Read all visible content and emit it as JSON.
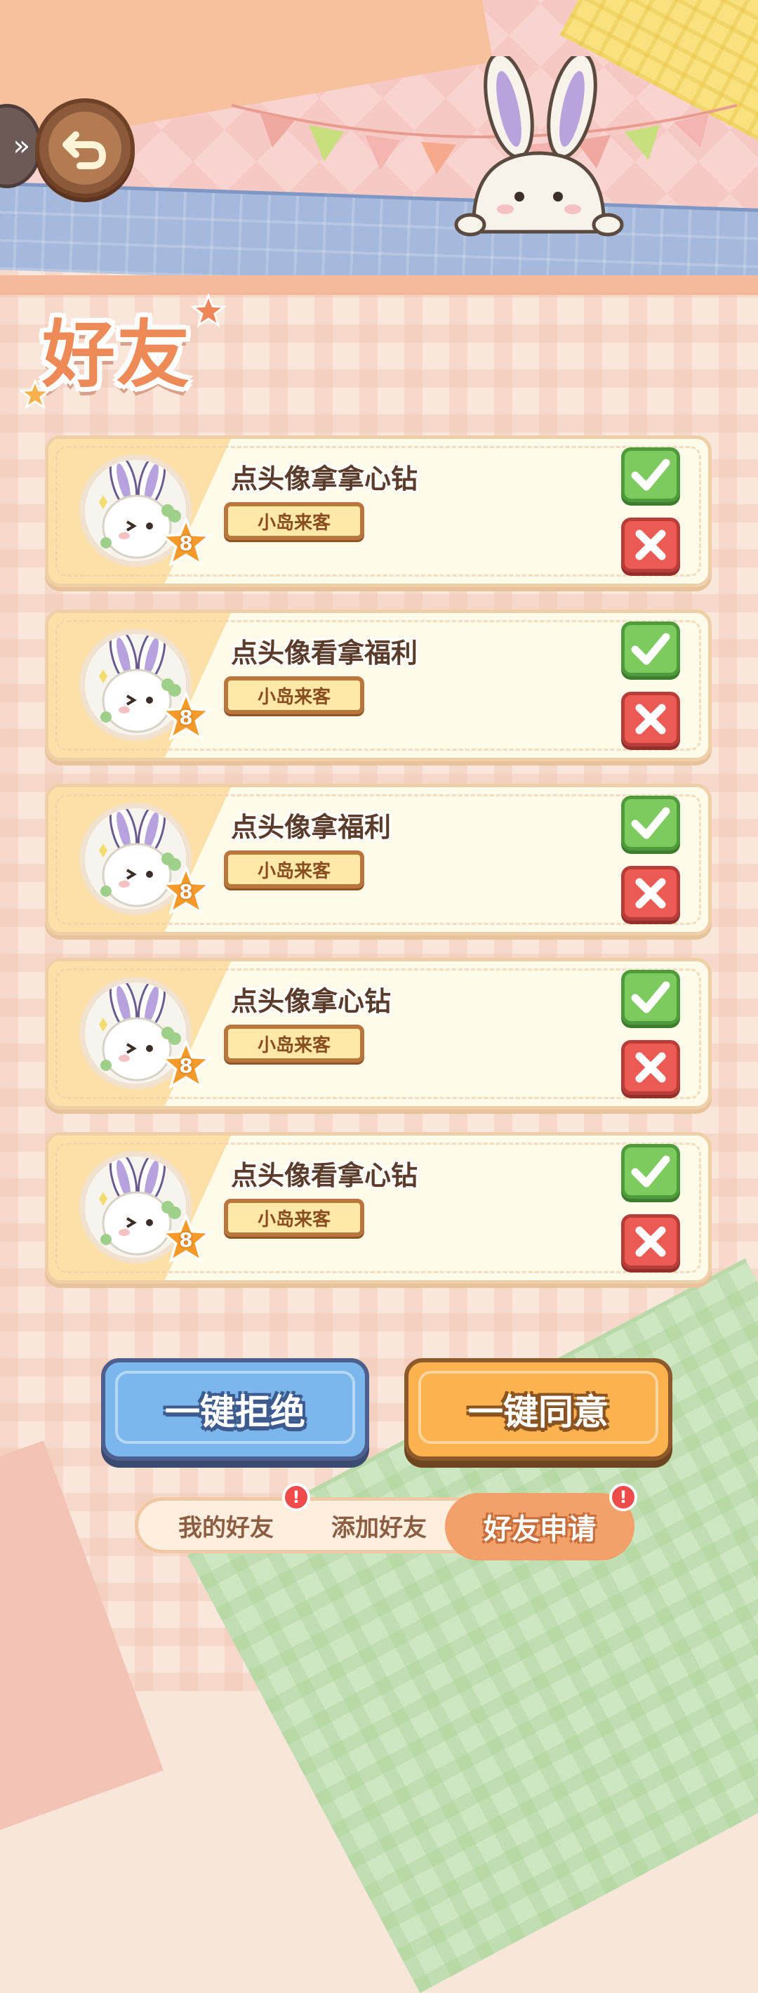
{
  "title": "好友",
  "header": {
    "back_icon": "back-arrow-icon",
    "side_icon": "chevron-right-icon"
  },
  "requests": [
    {
      "name": "点头像拿拿心钻",
      "tag": "小岛来客",
      "level": "8"
    },
    {
      "name": "点头像看拿福利",
      "tag": "小岛来客",
      "level": "8"
    },
    {
      "name": "点头像拿福利",
      "tag": "小岛来客",
      "level": "8"
    },
    {
      "name": "点头像拿心钻",
      "tag": "小岛来客",
      "level": "8"
    },
    {
      "name": "点头像看拿心钻",
      "tag": "小岛来客",
      "level": "8"
    }
  ],
  "actions": {
    "reject_all": "一键拒绝",
    "accept_all": "一键同意"
  },
  "tabs": {
    "my_friends": "我的好友",
    "add_friend": "添加好友",
    "friend_requests": "好友申请",
    "badge": "!"
  },
  "colors": {
    "accept_green": "#7dca5e",
    "reject_red": "#ec5a54",
    "reject_all_blue": "#7bb7ec",
    "accept_all_orange": "#fbb24f",
    "active_tab": "#f4a06b"
  }
}
